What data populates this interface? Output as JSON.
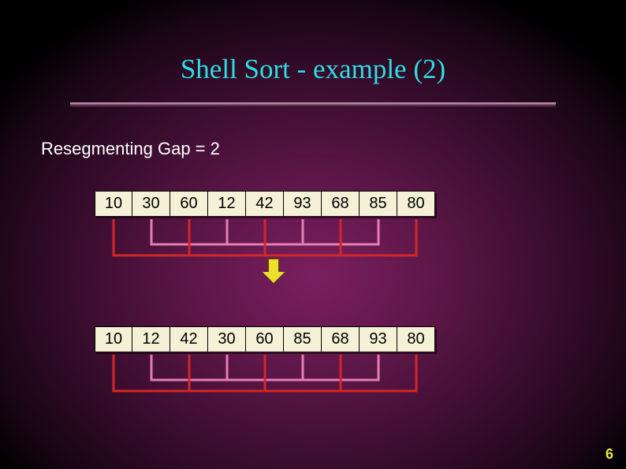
{
  "title": "Shell Sort - example (2)",
  "subtitle": "Resegmenting Gap = 2",
  "array1": [
    "10",
    "30",
    "60",
    "12",
    "42",
    "93",
    "68",
    "85",
    "80"
  ],
  "array2": [
    "10",
    "12",
    "42",
    "30",
    "60",
    "85",
    "68",
    "93",
    "80"
  ],
  "pageNumber": "6",
  "colors": {
    "group1": "#d42626",
    "group2": "#e47fb4"
  },
  "chart_data": {
    "type": "table",
    "title": "Shell Sort resegmenting pass with gap = 2",
    "before": [
      10,
      30,
      60,
      12,
      42,
      93,
      68,
      85,
      80
    ],
    "after": [
      10,
      12,
      42,
      30,
      60,
      85,
      68,
      93,
      80
    ],
    "gap": 2,
    "groups": [
      {
        "indices": [
          0,
          2,
          4,
          6,
          8
        ],
        "color": "#d42626"
      },
      {
        "indices": [
          1,
          3,
          5,
          7
        ],
        "color": "#e47fb4"
      }
    ]
  }
}
